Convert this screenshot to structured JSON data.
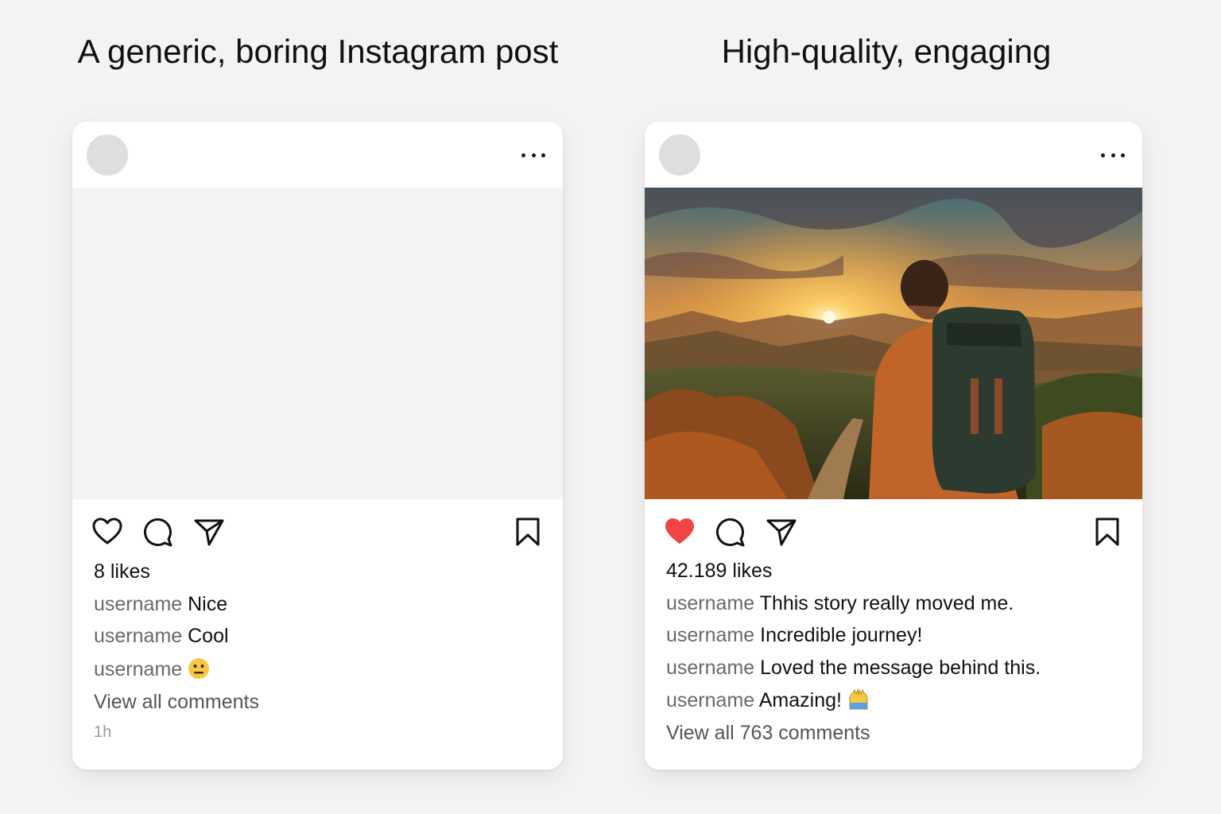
{
  "headings": {
    "left": "A generic, boring Instagram post",
    "right": "High-quality, engaging"
  },
  "left_post": {
    "likes": "8 likes",
    "comments": [
      {
        "user": "username",
        "text": "Nice"
      },
      {
        "user": "username",
        "text": "Cool"
      },
      {
        "user": "username",
        "text": "",
        "emoji": "neutral-face-emoji"
      }
    ],
    "view_all": "View all comments",
    "time": "1h",
    "liked": false
  },
  "right_post": {
    "likes": "42.189 likes",
    "comments": [
      {
        "user": "username",
        "text": "Thhis story really moved me."
      },
      {
        "user": "username",
        "text": "Incredible journey!"
      },
      {
        "user": "username",
        "text": "Loved the message behind this."
      },
      {
        "user": "username",
        "text": "Amazing!",
        "emoji": "raised-hands-emoji"
      }
    ],
    "view_all": "View all 763 comments",
    "liked": true
  },
  "colors": {
    "like_active": "#f04545",
    "background": "#f3f3f3",
    "avatar": "#dedede"
  },
  "icons": [
    "heart-icon",
    "comment-icon",
    "share-icon",
    "bookmark-icon",
    "more-options-icon"
  ]
}
